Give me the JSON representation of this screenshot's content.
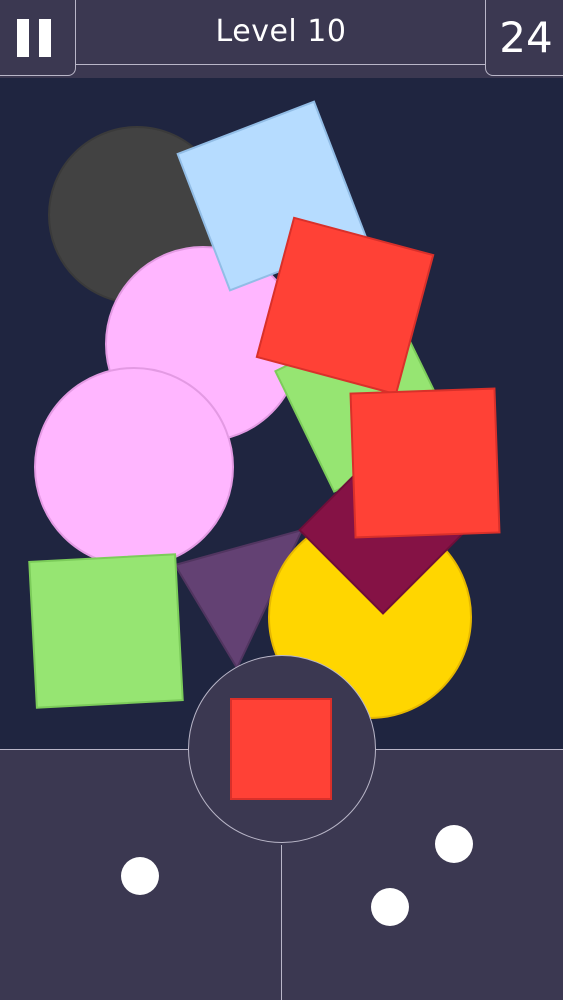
{
  "header": {
    "level_title": "Level 10",
    "shape_count": "24"
  },
  "colors": {
    "background": "#1f2540",
    "panel": "#3b3851",
    "border": "#b9b6c8",
    "dark_gray": "#424242",
    "light_blue": "#b6dcff",
    "pink": "#ffb6ff",
    "red": "#ff4136",
    "light_green": "#96e572",
    "maroon": "#851245",
    "purple": "#634173",
    "yellow": "#ffd600",
    "white": "#ffffff"
  },
  "board": {
    "shapes": [
      {
        "kind": "circle",
        "color": "dark_gray"
      },
      {
        "kind": "circle",
        "color": "pink"
      },
      {
        "kind": "square",
        "color": "light_blue"
      },
      {
        "kind": "square",
        "color": "light_green"
      },
      {
        "kind": "square",
        "color": "red"
      },
      {
        "kind": "circle",
        "color": "pink"
      },
      {
        "kind": "triangle",
        "color": "purple"
      },
      {
        "kind": "circle",
        "color": "yellow"
      },
      {
        "kind": "square",
        "color": "maroon"
      },
      {
        "kind": "square",
        "color": "red"
      },
      {
        "kind": "square",
        "color": "light_green"
      }
    ]
  },
  "launcher": {
    "current_shape": {
      "kind": "square",
      "color": "red"
    }
  },
  "lanes": {
    "left_dots": 1,
    "right_dots": 2
  }
}
